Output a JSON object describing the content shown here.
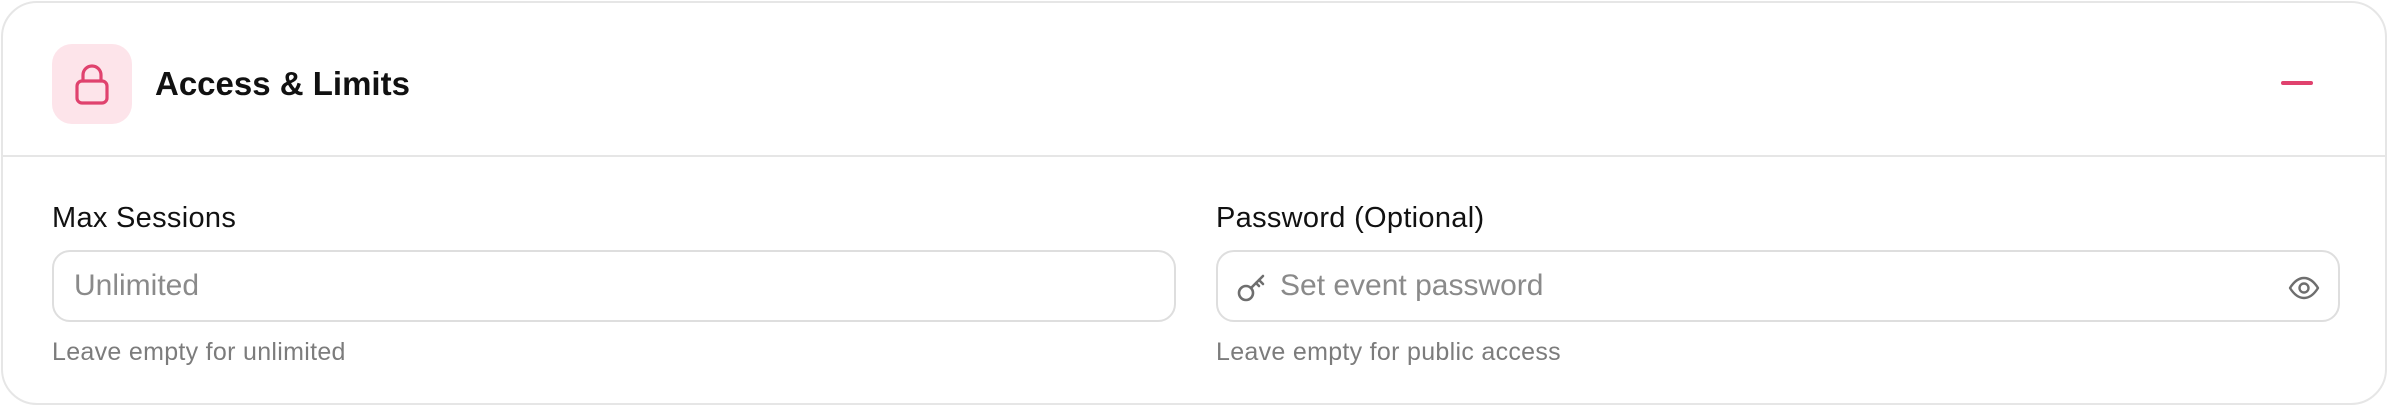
{
  "section": {
    "title": "Access & Limits",
    "lock_icon": "lock-icon",
    "collapse_icon": "minus-icon",
    "accent_color": "#e0426e",
    "icon_bg_color": "#fde4ea"
  },
  "max_sessions": {
    "label": "Max Sessions",
    "placeholder": "Unlimited",
    "value": "",
    "hint": "Leave empty for unlimited"
  },
  "password": {
    "label": "Password (Optional)",
    "placeholder": "Set event password",
    "value": "",
    "hint": "Leave empty for public access",
    "leading_icon": "key-icon",
    "trailing_icon": "eye-icon"
  }
}
